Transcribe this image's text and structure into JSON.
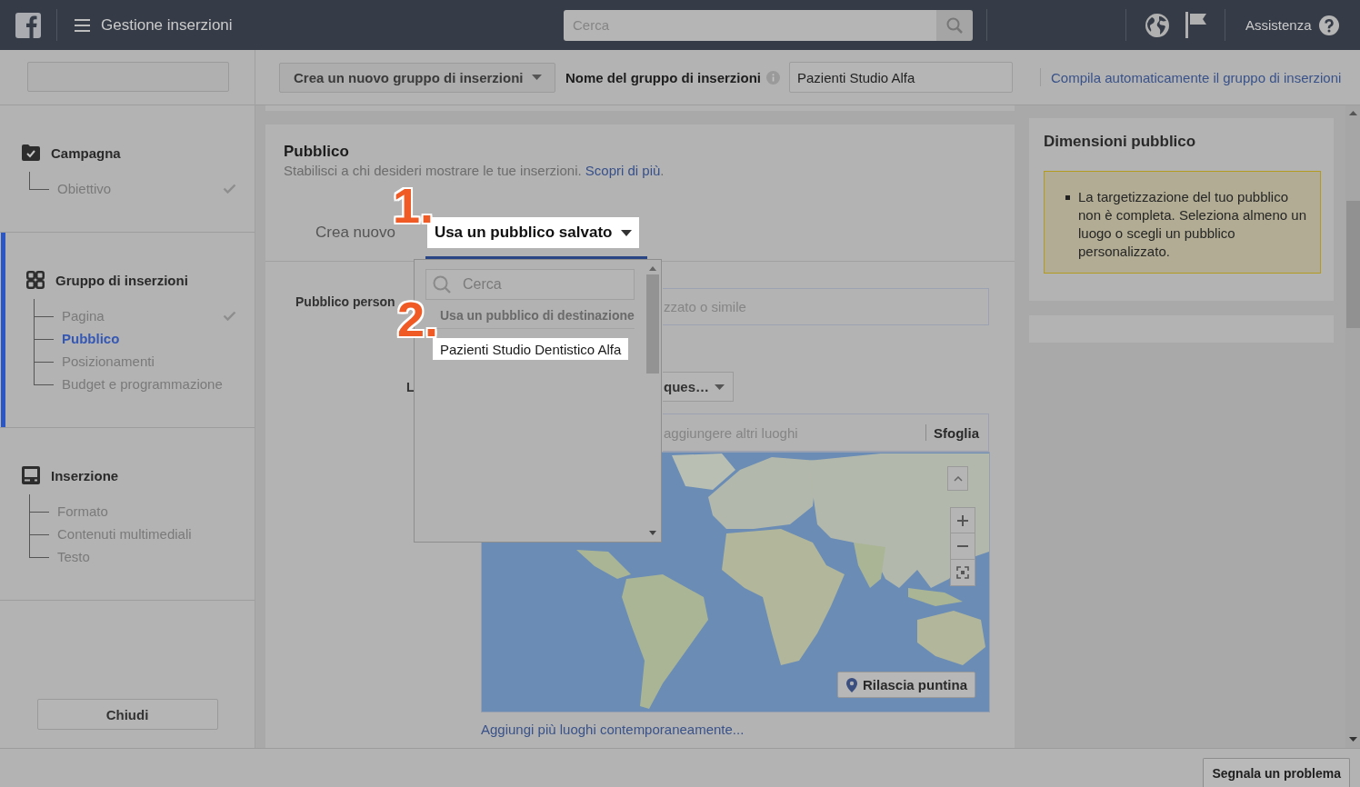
{
  "topbar": {
    "title": "Gestione inserzioni",
    "search": {
      "placeholder": "Cerca"
    },
    "help": "Assistenza"
  },
  "sidebar": {
    "sections": [
      {
        "kind": "campaign",
        "title": "Campagna",
        "selected": false,
        "items": [
          {
            "label": "Obiettivo",
            "selected": false,
            "done": true
          }
        ]
      },
      {
        "kind": "adset",
        "title": "Gruppo di inserzioni",
        "selected": true,
        "items": [
          {
            "label": "Pagina",
            "selected": false,
            "done": true
          },
          {
            "label": "Pubblico",
            "selected": true,
            "done": false
          },
          {
            "label": "Posizionamenti",
            "selected": false,
            "done": false
          },
          {
            "label": "Budget e programmazione",
            "selected": false,
            "done": false
          }
        ]
      },
      {
        "kind": "ad",
        "title": "Inserzione",
        "selected": false,
        "items": [
          {
            "label": "Formato",
            "selected": false,
            "done": false
          },
          {
            "label": "Contenuti multimediali",
            "selected": false,
            "done": false
          },
          {
            "label": "Testo",
            "selected": false,
            "done": false
          }
        ]
      }
    ],
    "close_button": "Chiudi"
  },
  "toolbar": {
    "create_button": "Crea un nuovo gruppo di inserzioni",
    "name_label": "Nome del gruppo di inserzioni",
    "name_field": {
      "value": "Pazienti Studio Alfa"
    },
    "autofill_link": "Compila automaticamente il gruppo di inserzioni"
  },
  "audience": {
    "title": "Pubblico",
    "description": "Stabilisci a chi desideri mostrare le tue inserzioni.",
    "learn_more_link": "Scopri di più",
    "description_end": ".",
    "tabs": [
      {
        "label": "Crea nuovo",
        "kind": "plain",
        "selected": false,
        "highlighted": false
      },
      {
        "label": "Usa un pubblico salvato",
        "kind": "menu",
        "selected": true,
        "highlighted": true,
        "annotation": "1."
      }
    ],
    "custom_audience": {
      "label": "Pubblico person",
      "field": {
        "placeholder": "zzato o simile"
      }
    },
    "locations": {
      "label": "L",
      "filter_button": "ques…",
      "search": {
        "placeholder": "aggiungere altri luoghi"
      },
      "browse_button": "Sfoglia",
      "pin_button": "Rilascia puntina",
      "add_many_link": "Aggiungi più luoghi contemporaneamente..."
    },
    "saved_audience_menu": {
      "search": {
        "placeholder": "Cerca"
      },
      "header": "Usa un pubblico di destinazione",
      "items": [
        {
          "label": "Pazienti Studio Dentistico Alfa",
          "selected": false,
          "highlighted": true,
          "annotation": "2."
        }
      ]
    }
  },
  "audience_size": {
    "title": "Dimensioni pubblico",
    "warnings": [
      "La targetizzazione del tuo pubblico non è completa. Seleziona almeno un luogo o scegli un pubblico personalizzato."
    ]
  },
  "footer": {
    "report_button": "Segnala un problema"
  }
}
